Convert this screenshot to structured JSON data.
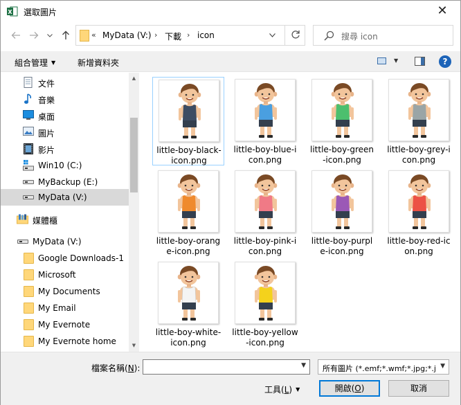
{
  "window": {
    "title": "選取圖片",
    "close_symbol": "✕"
  },
  "nav": {
    "address": {
      "overflow": "«",
      "segments": [
        "MyData (V:)",
        "下載",
        "icon"
      ]
    },
    "search_placeholder": "搜尋 icon"
  },
  "commands": {
    "organize": "組合管理",
    "new_folder": "新增資料夾",
    "help": "?"
  },
  "sidebar": {
    "items": [
      {
        "label": "文件",
        "icon": "document-icon"
      },
      {
        "label": "音樂",
        "icon": "music-icon"
      },
      {
        "label": "桌面",
        "icon": "desktop-icon"
      },
      {
        "label": "圖片",
        "icon": "pictures-icon"
      },
      {
        "label": "影片",
        "icon": "videos-icon"
      },
      {
        "label": "Win10 (C:)",
        "icon": "system-drive-icon"
      },
      {
        "label": "MyBackup (E:)",
        "icon": "drive-icon"
      },
      {
        "label": "MyData (V:)",
        "icon": "drive-icon",
        "selected": true
      },
      {
        "label": "媒體櫃",
        "icon": "libraries-icon"
      },
      {
        "label": "MyData (V:)",
        "icon": "drive-icon"
      },
      {
        "label": "Google Downloads-1",
        "icon": "folder-icon"
      },
      {
        "label": "Microsoft",
        "icon": "folder-icon"
      },
      {
        "label": "My Documents",
        "icon": "folder-icon"
      },
      {
        "label": "My Email",
        "icon": "folder-icon"
      },
      {
        "label": "My Evernote",
        "icon": "folder-icon"
      },
      {
        "label": "My Evernote home",
        "icon": "folder-icon"
      }
    ]
  },
  "files": [
    {
      "name": "little-boy-black-icon.png",
      "line1": "little-boy-black-",
      "line2": "icon.png",
      "shirt": "#3d4d63"
    },
    {
      "name": "little-boy-blue-icon.png",
      "line1": "little-boy-blue-i",
      "line2": "con.png",
      "shirt": "#4a9fe0"
    },
    {
      "name": "little-boy-green-icon.png",
      "line1": "little-boy-green",
      "line2": "-icon.png",
      "shirt": "#4cbf6e"
    },
    {
      "name": "little-boy-grey-icon.png",
      "line1": "little-boy-grey-i",
      "line2": "con.png",
      "shirt": "#9aa5a6"
    },
    {
      "name": "little-boy-orange-icon.png",
      "line1": "little-boy-orang",
      "line2": "e-icon.png",
      "shirt": "#ef8a2d"
    },
    {
      "name": "little-boy-pink-icon.png",
      "line1": "little-boy-pink-i",
      "line2": "con.png",
      "shirt": "#f07a86"
    },
    {
      "name": "little-boy-purple-icon.png",
      "line1": "little-boy-purpl",
      "line2": "e-icon.png",
      "shirt": "#9b59b6"
    },
    {
      "name": "little-boy-red-icon.png",
      "line1": "little-boy-red-ic",
      "line2": "on.png",
      "shirt": "#ec5245"
    },
    {
      "name": "little-boy-white-icon.png",
      "line1": "little-boy-white-",
      "line2": "icon.png",
      "shirt": "#f4f4f4"
    },
    {
      "name": "little-boy-yellow-icon.png",
      "line1": "little-boy-yellow",
      "line2": "-icon.png",
      "shirt": "#f4d21c"
    }
  ],
  "bottom": {
    "filename_label": "檔案名稱(N):",
    "filename_value": "",
    "filter_value": "所有圖片 (*.emf;*.wmf;*.jpg;*.j",
    "tools": "工具(L)",
    "open": "開啟(O)",
    "cancel": "取消"
  }
}
